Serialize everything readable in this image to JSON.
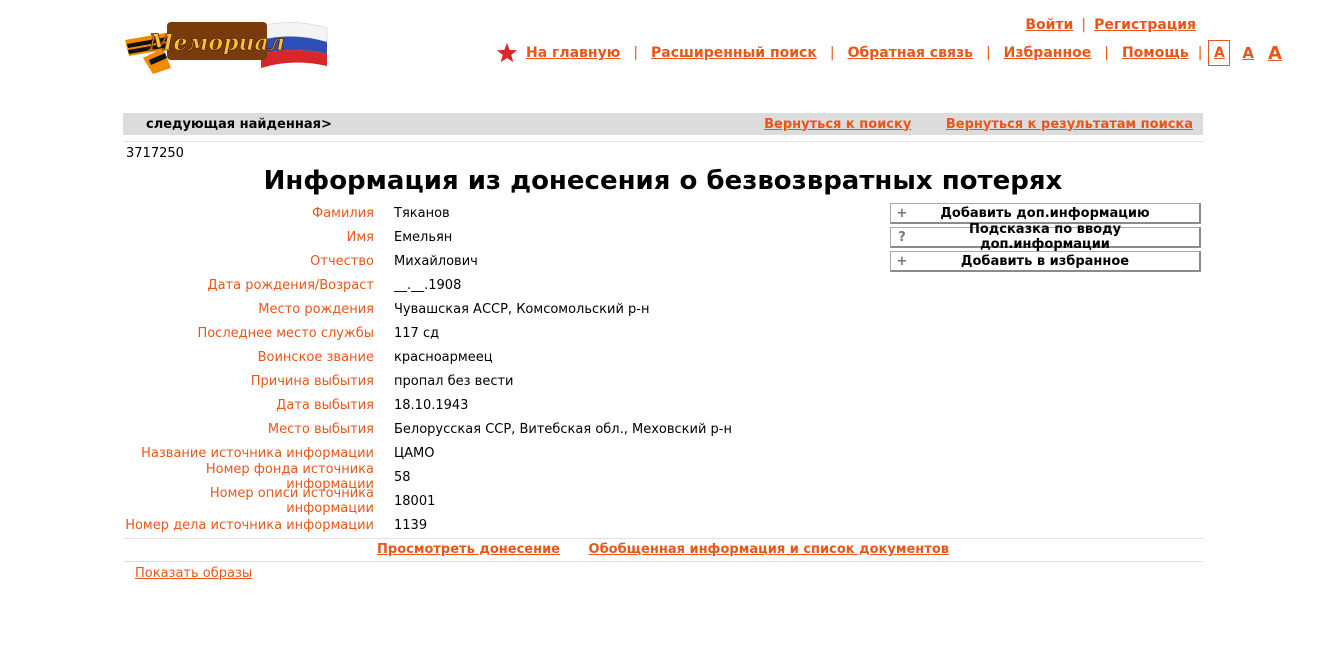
{
  "header": {
    "logo_text": "Мемориал",
    "auth": {
      "login": "Войти",
      "register": "Регистрация"
    },
    "nav": [
      {
        "label": "На главную"
      },
      {
        "label": "Расширенный поиск"
      },
      {
        "label": "Обратная связь"
      },
      {
        "label": "Избранное"
      },
      {
        "label": "Помощь"
      }
    ],
    "font_sizes": [
      "A",
      "A",
      "A"
    ]
  },
  "navbar": {
    "next_found": "следующая найденная",
    "next_arrow": ">",
    "back_to_search": "Вернуться к поиску",
    "back_to_results": "Вернуться к результатам поиска"
  },
  "record": {
    "id": "3717250",
    "title": "Информация из донесения о безвозвратных потерях",
    "fields": [
      {
        "label": "Фамилия",
        "value": "Тяканов"
      },
      {
        "label": "Имя",
        "value": "Емельян"
      },
      {
        "label": "Отчество",
        "value": "Михайлович"
      },
      {
        "label": "Дата рождения/Возраст",
        "value": "__.__.1908"
      },
      {
        "label": "Место рождения",
        "value": "Чувашская АССР, Комсомольский р-н"
      },
      {
        "label": "Последнее место службы",
        "value": "117 сд"
      },
      {
        "label": "Воинское звание",
        "value": "красноармеец"
      },
      {
        "label": "Причина выбытия",
        "value": "пропал без вести"
      },
      {
        "label": "Дата выбытия",
        "value": "18.10.1943"
      },
      {
        "label": "Место выбытия",
        "value": "Белорусская ССР, Витебская обл., Меховский р-н"
      },
      {
        "label": "Название источника информации",
        "value": "ЦАМО"
      },
      {
        "label": "Номер фонда источника информации",
        "value": "58"
      },
      {
        "label": "Номер описи источника информации",
        "value": "18001"
      },
      {
        "label": "Номер дела источника информации",
        "value": "1139"
      }
    ]
  },
  "actions": {
    "add_info": {
      "icon": "+",
      "label": "Добавить доп.информацию"
    },
    "hint": {
      "icon": "?",
      "label": "Подсказка по вводу доп.информации"
    },
    "add_fav": {
      "icon": "+",
      "label": "Добавить в избранное"
    }
  },
  "footer": {
    "view_report": "Просмотреть донесение",
    "summary": "Обобщенная информация и список документов",
    "show_images": "Показать образы"
  },
  "colors": {
    "accent": "#e8561a",
    "bar": "#dcdcdc",
    "star": "#d92a2a"
  }
}
